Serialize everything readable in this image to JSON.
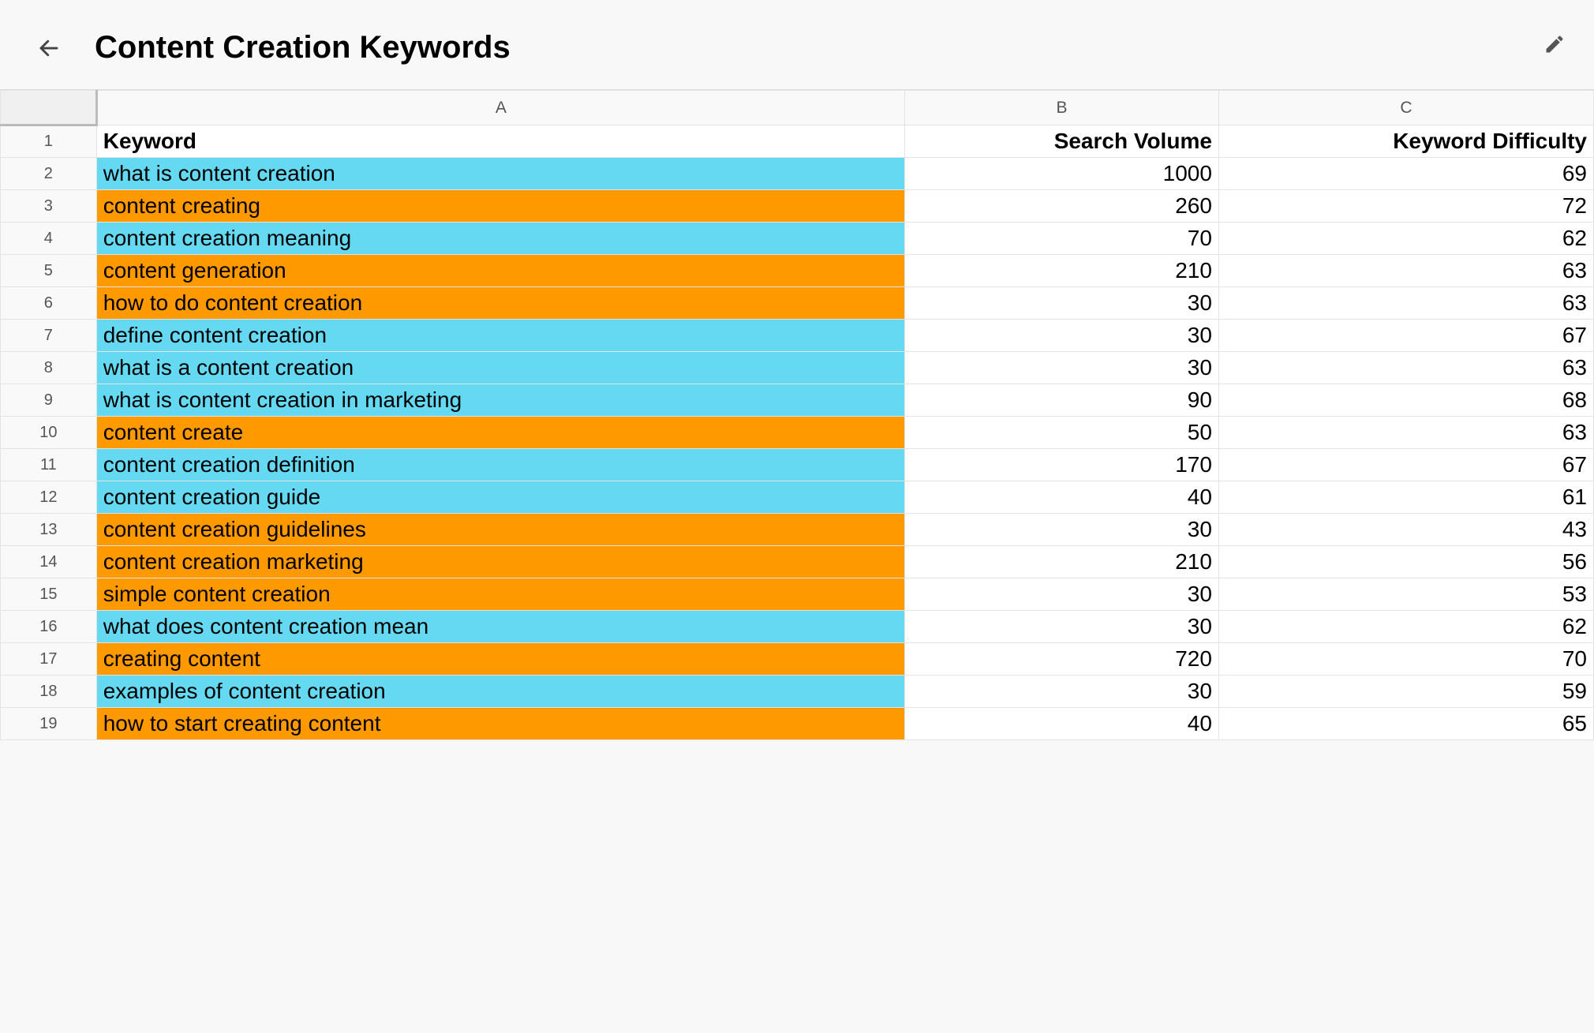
{
  "header": {
    "title": "Content Creation Keywords"
  },
  "columns": {
    "A": "A",
    "B": "B",
    "C": "C"
  },
  "headers": {
    "keyword": "Keyword",
    "volume": "Search Volume",
    "difficulty": "Keyword Difficulty"
  },
  "rows": [
    {
      "n": 2,
      "kw": "what is content creation",
      "vol": 1000,
      "diff": 69,
      "color": "blue"
    },
    {
      "n": 3,
      "kw": "content creating",
      "vol": 260,
      "diff": 72,
      "color": "orange"
    },
    {
      "n": 4,
      "kw": "content creation meaning",
      "vol": 70,
      "diff": 62,
      "color": "blue"
    },
    {
      "n": 5,
      "kw": "content generation",
      "vol": 210,
      "diff": 63,
      "color": "orange"
    },
    {
      "n": 6,
      "kw": "how to do content creation",
      "vol": 30,
      "diff": 63,
      "color": "orange"
    },
    {
      "n": 7,
      "kw": "define content creation",
      "vol": 30,
      "diff": 67,
      "color": "blue"
    },
    {
      "n": 8,
      "kw": "what is a content creation",
      "vol": 30,
      "diff": 63,
      "color": "blue"
    },
    {
      "n": 9,
      "kw": "what is content creation in marketing",
      "vol": 90,
      "diff": 68,
      "color": "blue"
    },
    {
      "n": 10,
      "kw": "content create",
      "vol": 50,
      "diff": 63,
      "color": "orange"
    },
    {
      "n": 11,
      "kw": "content creation definition",
      "vol": 170,
      "diff": 67,
      "color": "blue"
    },
    {
      "n": 12,
      "kw": "content creation guide",
      "vol": 40,
      "diff": 61,
      "color": "blue"
    },
    {
      "n": 13,
      "kw": "content creation guidelines",
      "vol": 30,
      "diff": 43,
      "color": "orange"
    },
    {
      "n": 14,
      "kw": "content creation marketing",
      "vol": 210,
      "diff": 56,
      "color": "orange"
    },
    {
      "n": 15,
      "kw": "simple content creation",
      "vol": 30,
      "diff": 53,
      "color": "orange"
    },
    {
      "n": 16,
      "kw": "what does content creation mean",
      "vol": 30,
      "diff": 62,
      "color": "blue"
    },
    {
      "n": 17,
      "kw": "creating content",
      "vol": 720,
      "diff": 70,
      "color": "orange"
    },
    {
      "n": 18,
      "kw": "examples of content creation",
      "vol": 30,
      "diff": 59,
      "color": "blue"
    },
    {
      "n": 19,
      "kw": "how to start creating content",
      "vol": 40,
      "diff": 65,
      "color": "orange"
    }
  ]
}
